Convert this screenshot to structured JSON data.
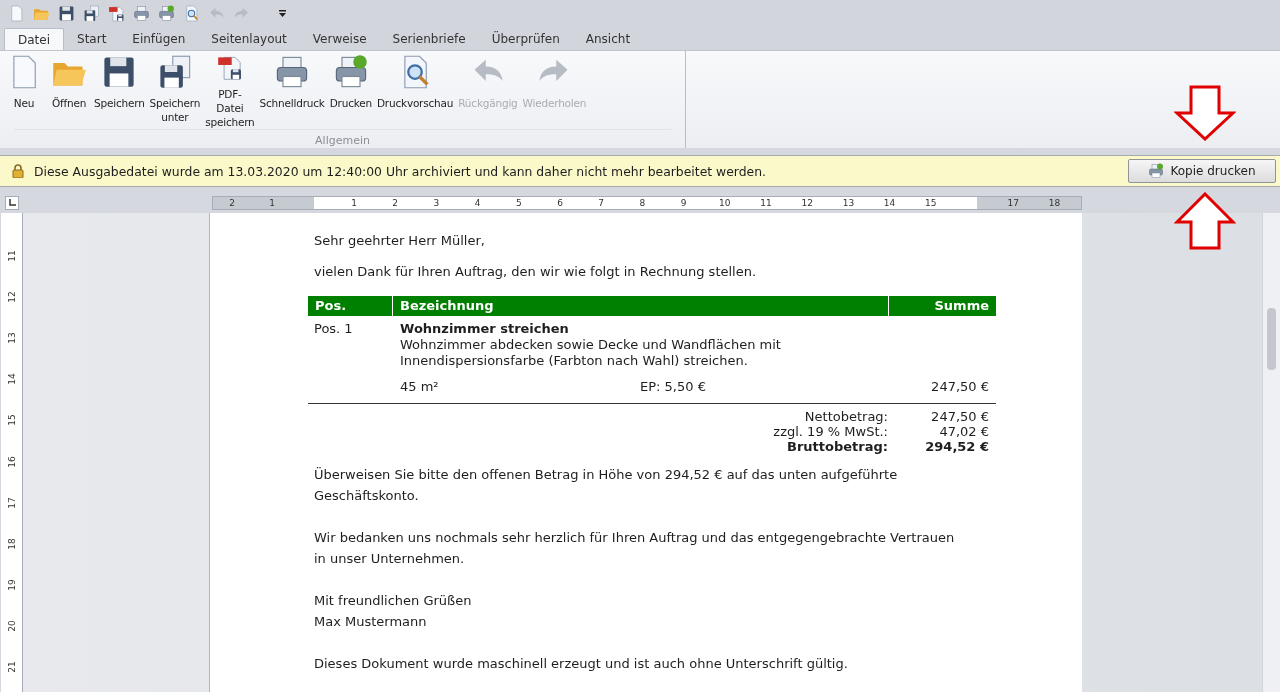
{
  "quick_access": [
    {
      "kind": "new"
    },
    {
      "kind": "open"
    },
    {
      "kind": "save"
    },
    {
      "kind": "saveas"
    },
    {
      "kind": "pdf"
    },
    {
      "kind": "quickprint"
    },
    {
      "kind": "print"
    },
    {
      "kind": "preview"
    },
    {
      "kind": "undo",
      "disabled": true
    },
    {
      "kind": "redo",
      "disabled": true
    }
  ],
  "tabs": [
    {
      "label": "Datei",
      "selected": true
    },
    {
      "label": "Start",
      "selected": false
    },
    {
      "label": "Einfügen",
      "selected": false
    },
    {
      "label": "Seitenlayout",
      "selected": false
    },
    {
      "label": "Verweise",
      "selected": false
    },
    {
      "label": "Serienbriefe",
      "selected": false
    },
    {
      "label": "Überprüfen",
      "selected": false
    },
    {
      "label": "Ansicht",
      "selected": false
    }
  ],
  "ribbon": {
    "group_label": "Allgemein",
    "buttons": [
      {
        "kind": "new",
        "label": "Neu",
        "disabled": false
      },
      {
        "kind": "open",
        "label": "Öffnen",
        "disabled": false
      },
      {
        "kind": "save",
        "label": "Speichern",
        "disabled": false
      },
      {
        "kind": "saveas",
        "label": "Speichern unter",
        "disabled": false
      },
      {
        "kind": "pdf",
        "label": "PDF-Datei speichern",
        "disabled": false
      },
      {
        "kind": "quickprint",
        "label": "Schnelldruck",
        "disabled": false
      },
      {
        "kind": "print",
        "label": "Drucken",
        "disabled": false
      },
      {
        "kind": "preview",
        "label": "Druckvorschau",
        "disabled": false
      },
      {
        "kind": "undo",
        "label": "Rückgängig",
        "disabled": true
      },
      {
        "kind": "redo",
        "label": "Wiederholen",
        "disabled": true
      }
    ]
  },
  "infobar": {
    "message": "Diese Ausgabedatei wurde am 13.03.2020 um 12:40:00 Uhr archiviert und kann daher nicht mehr bearbeitet werden.",
    "button": "Kopie drucken"
  },
  "ruler_horizontal": [
    "2",
    "1",
    "1",
    "2",
    "3",
    "4",
    "5",
    "6",
    "7",
    "8",
    "9",
    "10",
    "11",
    "12",
    "13",
    "14",
    "15",
    "17",
    "18"
  ],
  "ruler_vertical": [
    "11",
    "12",
    "13",
    "14",
    "15",
    "16",
    "17",
    "18",
    "19",
    "20",
    "21"
  ],
  "document": {
    "salutation": "Sehr geehrter Herr Müller,",
    "intro": "vielen Dank für Ihren Auftrag, den wir wie folgt in Rechnung stellen.",
    "table": {
      "columns": [
        "Pos.",
        "Bezeichnung",
        "Summe"
      ],
      "rows": [
        {
          "position": "Pos. 1",
          "title": "Wohnzimmer streichen",
          "description": [
            "Wohnzimmer abdecken sowie Decke und Wandflächen mit",
            "Innendispersionsfarbe (Farbton nach Wahl) streichen."
          ],
          "quantity": "45 m²",
          "unit_price": "EP: 5,50 €",
          "total": "247,50 €"
        }
      ]
    },
    "totals": [
      {
        "label": "Nettobetrag:",
        "value": "247,50 €",
        "bold": false
      },
      {
        "label": "zzgl. 19 % MwSt.:",
        "value": "47,02 €",
        "bold": false
      },
      {
        "label": "Bruttobetrag:",
        "value": "294,52 €",
        "bold": true
      }
    ],
    "paragraphs": [
      [
        "Überweisen Sie bitte den offenen Betrag in Höhe von 294,52 € auf das unten aufgeführte",
        "Geschäftskonto."
      ],
      [
        "Wir bedanken uns nochmals sehr herzlich für Ihren Auftrag und das entgegengebrachte Vertrauen",
        "in unser Unternehmen."
      ],
      [
        "Mit freundlichen Grüßen",
        "Max Mustermann"
      ],
      [
        "Dieses Dokument wurde maschinell erzeugt und ist auch ohne Unterschrift gültig."
      ]
    ]
  }
}
